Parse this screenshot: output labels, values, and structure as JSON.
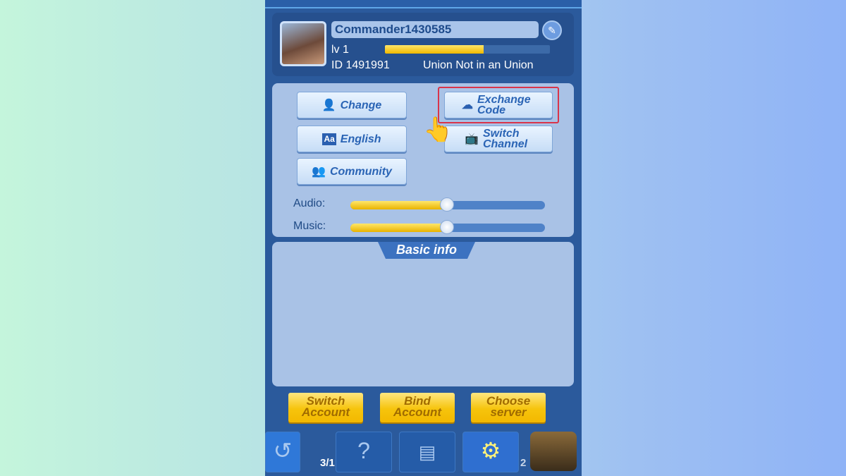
{
  "profile": {
    "name": "Commander1430585",
    "level": "lv 1",
    "level_progress": 0.6,
    "id": "ID 1491991",
    "union": "Union Not in an Union",
    "edit_icon": "edit-icon"
  },
  "settings": {
    "buttons": [
      {
        "label": "Change",
        "icon": "user-icon"
      },
      {
        "label": "Exchange Code",
        "icon": "gift-icon"
      },
      {
        "label": "English",
        "icon": "language-icon"
      },
      {
        "label": "Switch Channel",
        "icon": "tv-icon"
      },
      {
        "label": "Community",
        "icon": "group-icon"
      }
    ],
    "audio_label": "Audio:",
    "audio_level": 0.5,
    "music_label": "Music:",
    "music_level": 0.5
  },
  "basic_info": {
    "title": "Basic info"
  },
  "actions": [
    "Switch Account",
    "Bind Account",
    "Choose server"
  ],
  "nav": {
    "badge_left": "3/1",
    "badge_right": "2",
    "active": "settings"
  },
  "colors": {
    "highlight": "#d9344a",
    "accent": "#f6c40c"
  }
}
